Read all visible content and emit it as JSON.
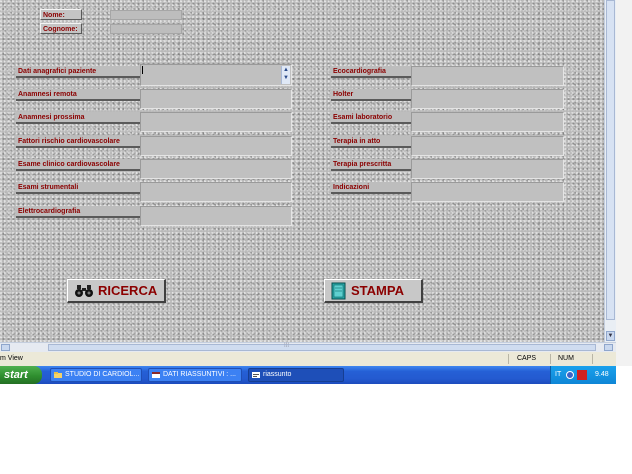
{
  "form": {
    "nome_label": "Nome:",
    "cognome_label": "Cognome:",
    "left_fields": [
      "Dati anagrafici paziente",
      "Anamnesi remota",
      "Anamnesi prossima",
      "Fattori rischio cardiovascolare",
      "Esame clinico cardiovascolare",
      "Esami strumentali",
      "Elettrocardiografia"
    ],
    "right_fields": [
      "Ecocardiografia",
      "Holter",
      "Esami laboratorio",
      "Terapia in atto",
      "Terapia prescritta",
      "Indicazioni"
    ],
    "ricerca_label": "RICERCA",
    "stampa_label": "STAMPA"
  },
  "statusbar": {
    "view_text": "m View",
    "caps": "CAPS",
    "num": "NUM"
  },
  "taskbar": {
    "start_label": "start",
    "tasks": [
      "STUDIO DI CARDIOL...",
      "DATI RIASSUNTIVI : ...",
      "riassunto"
    ],
    "tray_lang": "IT",
    "clock": "9.48"
  },
  "colors": {
    "label_text": "#8b0000",
    "taskbar_blue": "#245ad0",
    "start_green": "#2f8f2f"
  },
  "icons": {
    "ricerca": "binoculars-icon",
    "stampa": "book-icon",
    "scroll_up": "arrow-up-icon",
    "scroll_down": "arrow-down-icon"
  }
}
